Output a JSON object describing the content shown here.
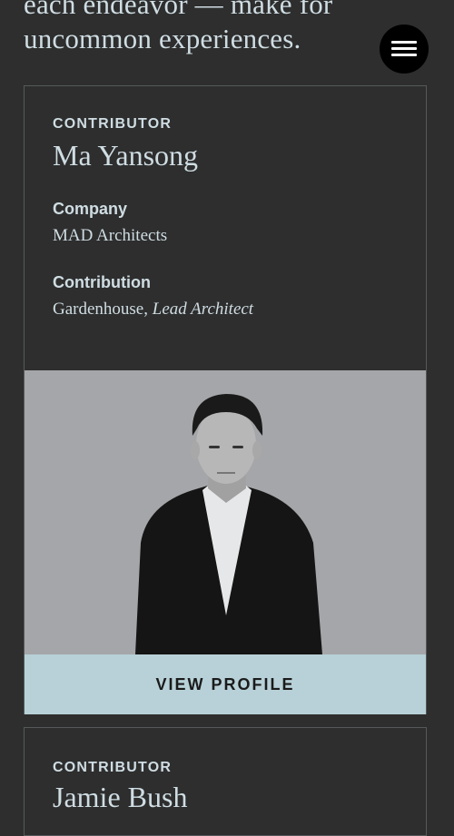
{
  "intro": {
    "line1": "each endeavor — make for",
    "line2": "uncommon experiences."
  },
  "menu": {
    "icon": "hamburger-menu-icon"
  },
  "contributors": [
    {
      "kicker": "CONTRIBUTOR",
      "name": "Ma Yansong",
      "company_label": "Company",
      "company": "MAD Architects",
      "contribution_label": "Contribution",
      "contribution_project": "Gardenhouse, ",
      "contribution_role": "Lead Architect",
      "button": "VIEW PROFILE"
    },
    {
      "kicker": "CONTRIBUTOR",
      "name": "Jamie Bush"
    }
  ],
  "colors": {
    "background": "#2e2e2e",
    "text": "#cfdde3",
    "button_bg": "#b8d1d8",
    "photo_bg": "#a5a6a9"
  }
}
